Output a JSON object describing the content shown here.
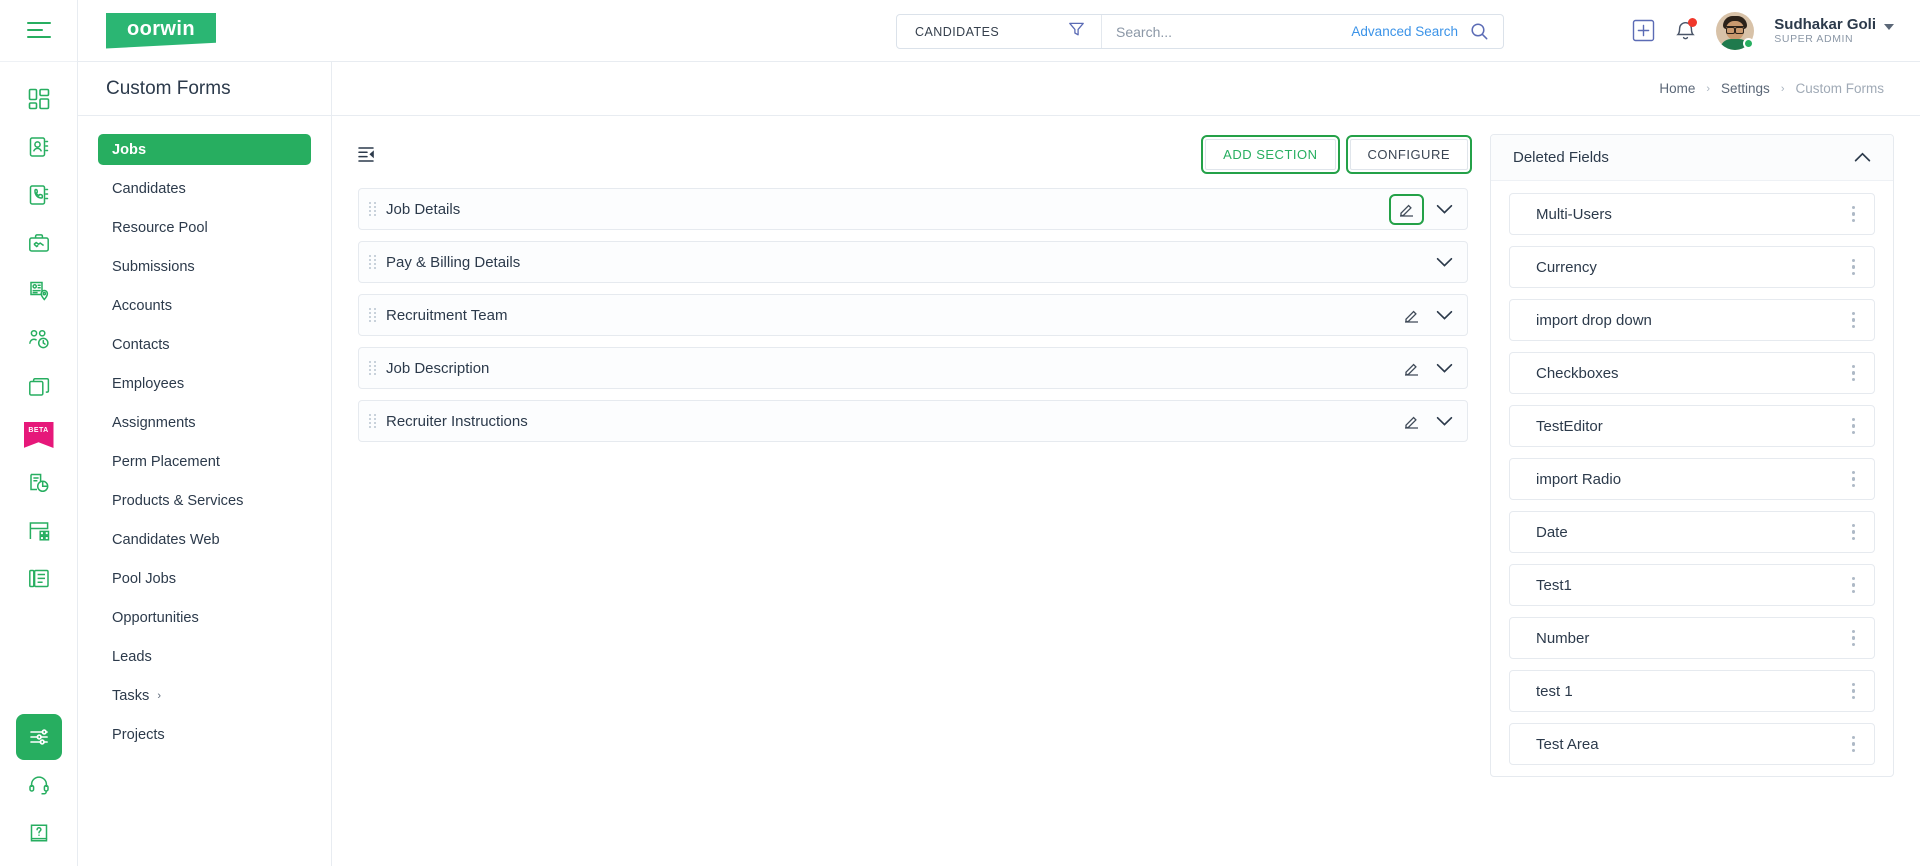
{
  "brand": {
    "name": "oorwin",
    "color": "#2bb673"
  },
  "accent": {
    "green": "#27ae60",
    "link": "#3b93e8",
    "badge_pink": "#e6187a",
    "alert_red": "#f0382b"
  },
  "rail": {
    "menu_icon": "hamburger-menu-icon",
    "items": [
      {
        "icon": "dashboard-icon",
        "name": "dashboard"
      },
      {
        "icon": "contacts-book-icon",
        "name": "candidates"
      },
      {
        "icon": "phone-book-icon",
        "name": "calls"
      },
      {
        "icon": "briefcase-handshake-icon",
        "name": "jobs"
      },
      {
        "icon": "resume-location-icon",
        "name": "submissions"
      },
      {
        "icon": "users-clock-icon",
        "name": "timesheets"
      },
      {
        "icon": "copy-layers-icon",
        "name": "assignments"
      },
      {
        "icon": "beta-ribbon-icon",
        "name": "beta",
        "badge": "BETA"
      },
      {
        "icon": "report-pie-icon",
        "name": "reports"
      },
      {
        "icon": "layout-grid-icon",
        "name": "widgets"
      },
      {
        "icon": "documents-icon",
        "name": "documents"
      }
    ],
    "bottom": [
      {
        "icon": "sliders-settings-icon",
        "name": "settings",
        "active": true
      },
      {
        "icon": "headset-support-icon",
        "name": "support",
        "active": false
      },
      {
        "icon": "help-book-icon",
        "name": "help",
        "active": false
      }
    ]
  },
  "search": {
    "scope_label": "CANDIDATES",
    "filter_icon": "funnel-filter-icon",
    "placeholder": "Search...",
    "value": "",
    "advanced_label": "Advanced Search",
    "search_icon": "magnifier-icon"
  },
  "topbar": {
    "add_icon": "plus-square-icon",
    "notification_icon": "bell-icon",
    "user_name": "Sudhakar Goli",
    "user_role": "SUPER ADMIN",
    "avatar_name": "user-avatar"
  },
  "page": {
    "title": "Custom Forms",
    "breadcrumb": [
      {
        "label": "Home",
        "current": false
      },
      {
        "label": "Settings",
        "current": false
      },
      {
        "label": "Custom Forms",
        "current": true
      }
    ],
    "breadcrumb_separator": "›"
  },
  "form_nav": {
    "items": [
      {
        "label": "Jobs",
        "active": true
      },
      {
        "label": "Candidates",
        "active": false
      },
      {
        "label": "Resource Pool",
        "active": false
      },
      {
        "label": "Submissions",
        "active": false
      },
      {
        "label": "Accounts",
        "active": false
      },
      {
        "label": "Contacts",
        "active": false
      },
      {
        "label": "Employees",
        "active": false
      },
      {
        "label": "Assignments",
        "active": false
      },
      {
        "label": "Perm Placement",
        "active": false
      },
      {
        "label": "Products & Services",
        "active": false
      },
      {
        "label": "Candidates Web",
        "active": false
      },
      {
        "label": "Pool Jobs",
        "active": false
      },
      {
        "label": "Opportunities",
        "active": false
      },
      {
        "label": "Leads",
        "active": false,
        "chevron": ""
      },
      {
        "label": "Tasks",
        "active": false,
        "chevron": "›"
      },
      {
        "label": "Projects",
        "active": false
      }
    ]
  },
  "toolbar": {
    "collapse_icon": "collapse-panel-icon",
    "add_section_label": "ADD SECTION",
    "configure_label": "CONFIGURE"
  },
  "sections": [
    {
      "title": "Job Details",
      "has_edit": true,
      "edit_highlighted": true
    },
    {
      "title": "Pay & Billing Details",
      "has_edit": false,
      "edit_highlighted": false
    },
    {
      "title": "Recruitment Team",
      "has_edit": true,
      "edit_highlighted": false
    },
    {
      "title": "Job Description",
      "has_edit": true,
      "edit_highlighted": false
    },
    {
      "title": "Recruiter Instructions",
      "has_edit": true,
      "edit_highlighted": false
    }
  ],
  "deleted_fields": {
    "title": "Deleted Fields",
    "toggle_icon": "chevron-up-icon",
    "expanded": true,
    "items": [
      {
        "label": "Multi-Users"
      },
      {
        "label": "Currency"
      },
      {
        "label": "import drop down"
      },
      {
        "label": "Checkboxes"
      },
      {
        "label": "TestEditor"
      },
      {
        "label": "import Radio"
      },
      {
        "label": "Date"
      },
      {
        "label": "Test1"
      },
      {
        "label": "Number"
      },
      {
        "label": "test 1"
      },
      {
        "label": "Test Area"
      }
    ]
  }
}
